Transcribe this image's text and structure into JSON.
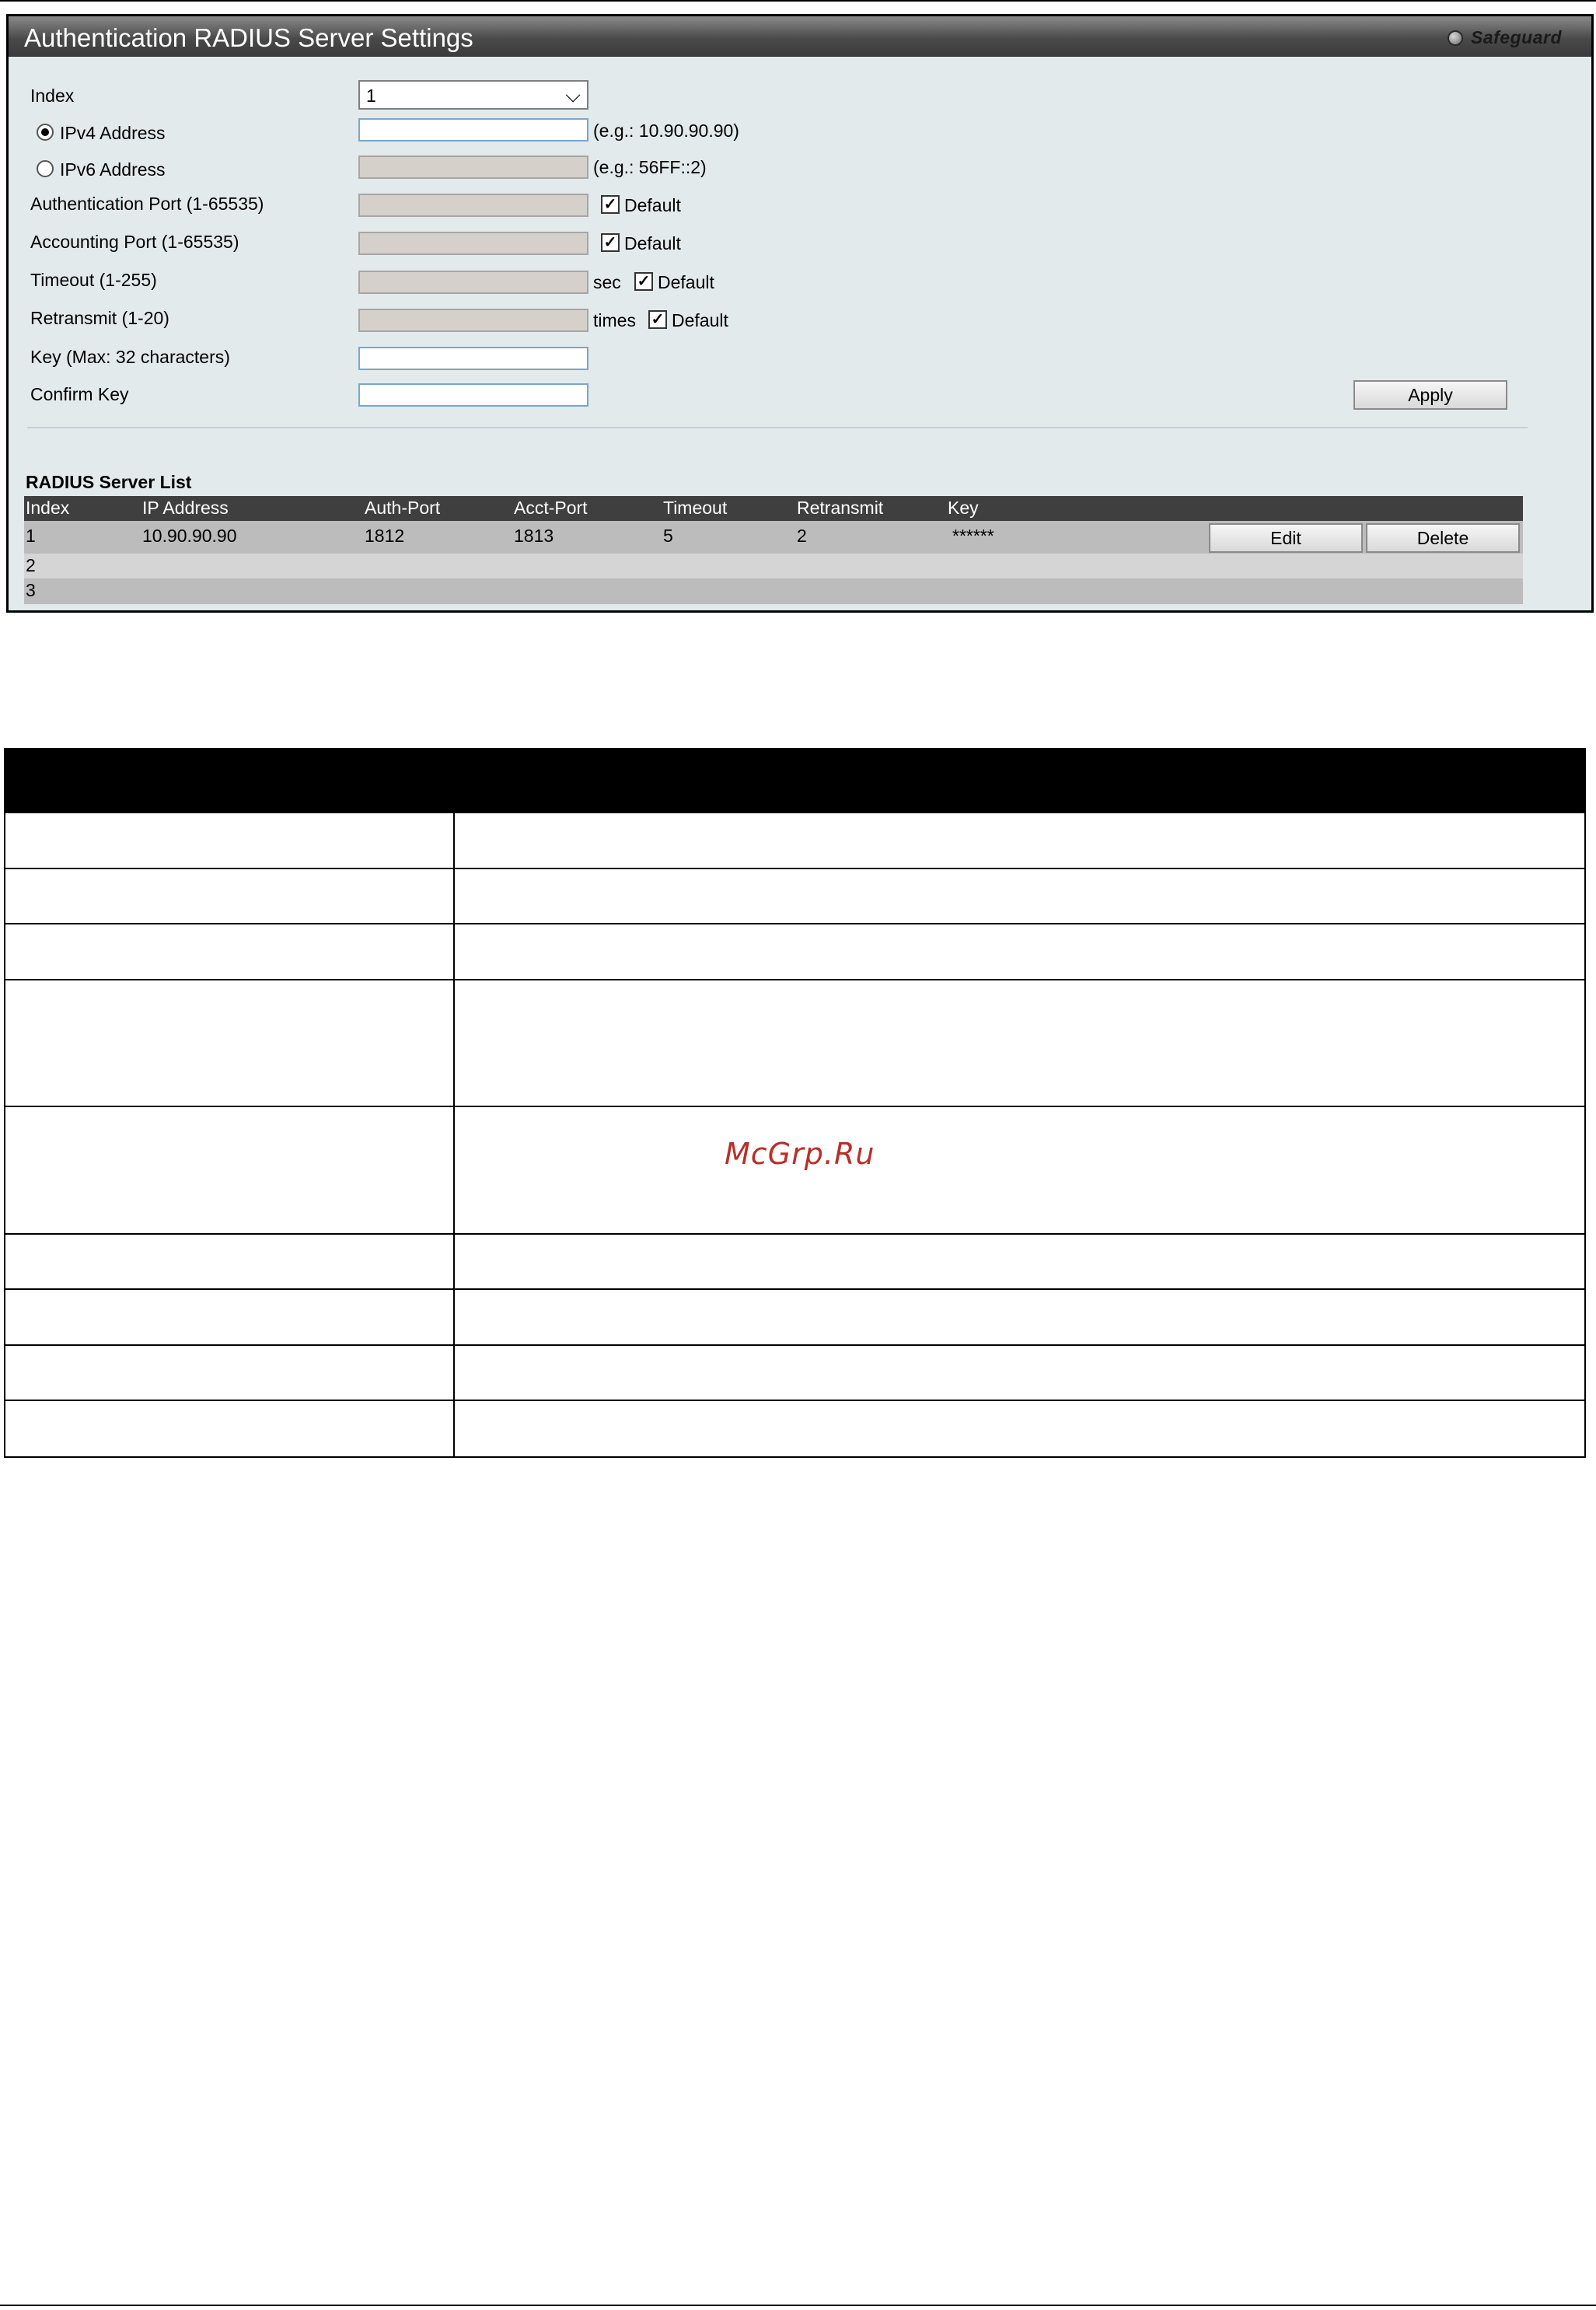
{
  "panel": {
    "title": "Authentication RADIUS Server Settings",
    "safeguard_label": "Safeguard"
  },
  "form": {
    "index_label": "Index",
    "index_value": "1",
    "ipv4_label": "IPv4 Address",
    "ipv4_value": "",
    "ipv4_hint": "(e.g.: 10.90.90.90)",
    "ipv6_label": "IPv6 Address",
    "ipv6_hint": "(e.g.: 56FF::2)",
    "auth_port_label": "Authentication Port (1-65535)",
    "acct_port_label": "Accounting Port (1-65535)",
    "timeout_label": "Timeout (1-255)",
    "timeout_unit": "sec",
    "retransmit_label": "Retransmit (1-20)",
    "retransmit_unit": "times",
    "default_label": "Default",
    "key_label": "Key (Max: 32 characters)",
    "confirm_key_label": "Confirm Key",
    "apply_label": "Apply",
    "ipv4_selected": true,
    "auth_default_checked": true,
    "acct_default_checked": true,
    "timeout_default_checked": true,
    "retransmit_default_checked": true
  },
  "server_list": {
    "title": "RADIUS Server List",
    "columns": [
      "Index",
      "IP Address",
      "Auth-Port",
      "Acct-Port",
      "Timeout",
      "Retransmit",
      "Key"
    ],
    "rows": [
      {
        "index": "1",
        "ip": "10.90.90.90",
        "auth_port": "1812",
        "acct_port": "1813",
        "timeout": "5",
        "retransmit": "2",
        "key": "******"
      },
      {
        "index": "2",
        "ip": "",
        "auth_port": "",
        "acct_port": "",
        "timeout": "",
        "retransmit": "",
        "key": ""
      },
      {
        "index": "3",
        "ip": "",
        "auth_port": "",
        "acct_port": "",
        "timeout": "",
        "retransmit": "",
        "key": ""
      }
    ],
    "edit_label": "Edit",
    "delete_label": "Delete"
  },
  "watermark": "McGrp.Ru",
  "colors": {
    "panel_bg": "#e3eaec",
    "list_header_bg": "#3f3f3f",
    "watermark": "#b8302a"
  }
}
